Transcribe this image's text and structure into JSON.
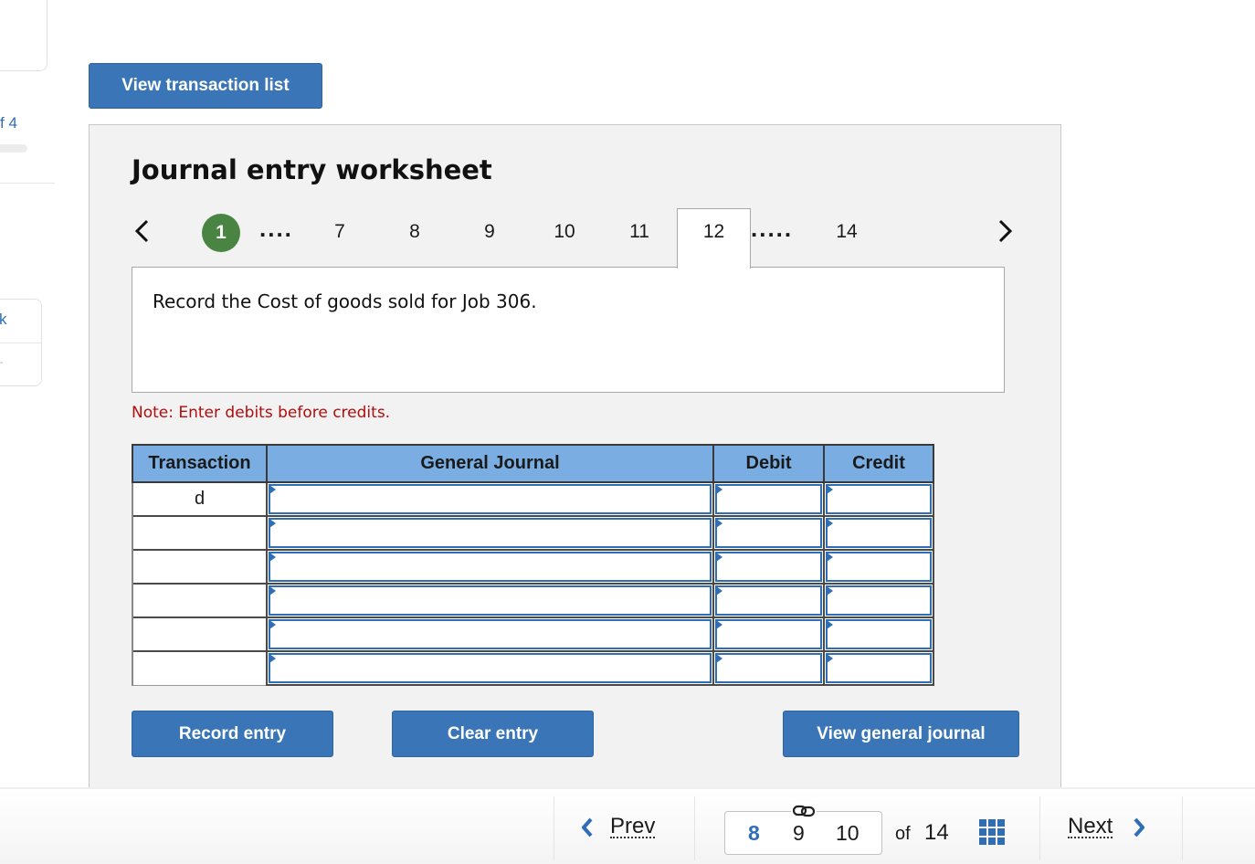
{
  "sidebar": {
    "progress_text": "f 4",
    "link_partial": "k"
  },
  "top": {
    "view_transaction_list_label": "View transaction list"
  },
  "worksheet": {
    "title": "Journal entry worksheet",
    "tabs": {
      "prev_icon": "chevron-left-icon",
      "next_icon": "chevron-right-icon",
      "completed": "1",
      "ellipsis_left": "....",
      "numbers": [
        "7",
        "8",
        "9",
        "10",
        "11"
      ],
      "active": "12",
      "ellipsis_right": ".....",
      "last": "14"
    },
    "prompt": "Record the Cost of goods sold for Job 306.",
    "note": "Note: Enter debits before credits.",
    "table": {
      "headers": [
        "Transaction",
        "General Journal",
        "Debit",
        "Credit"
      ],
      "rows": [
        {
          "transaction": "d",
          "general_journal": "",
          "debit": "",
          "credit": ""
        },
        {
          "transaction": "",
          "general_journal": "",
          "debit": "",
          "credit": ""
        },
        {
          "transaction": "",
          "general_journal": "",
          "debit": "",
          "credit": ""
        },
        {
          "transaction": "",
          "general_journal": "",
          "debit": "",
          "credit": ""
        },
        {
          "transaction": "",
          "general_journal": "",
          "debit": "",
          "credit": ""
        },
        {
          "transaction": "",
          "general_journal": "",
          "debit": "",
          "credit": ""
        }
      ]
    },
    "buttons": {
      "record": "Record entry",
      "clear": "Clear entry",
      "view_general_journal": "View general journal"
    }
  },
  "bottom_nav": {
    "prev_label": "Prev",
    "next_label": "Next",
    "pages": [
      "8",
      "9",
      "10"
    ],
    "current_page": "8",
    "of_label": "of",
    "total_pages": "14",
    "link_icon": "link-icon",
    "grid_icon": "grid-icon"
  },
  "colors": {
    "primary_button": "#3a75b7",
    "table_header": "#7aade1",
    "completed_badge": "#4a8443",
    "note_red": "#b20d0d",
    "link_blue": "#2f6db5",
    "panel_bg": "#f2f2f2"
  }
}
